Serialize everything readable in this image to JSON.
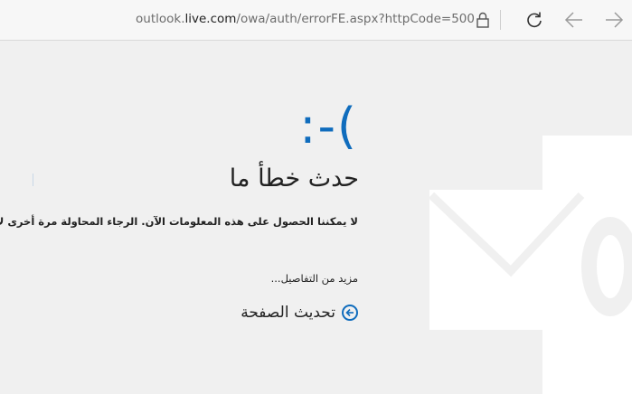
{
  "browser": {
    "url_prefix": "outlook.",
    "url_host": "live.com",
    "url_path": "/owa/auth/errorFE.aspx?httpCode=500",
    "url_full": "outlook.live.com/owa/auth/errorFE.aspx?httpCode=500"
  },
  "error": {
    "emoticon": ":-(",
    "heading": "حدث خطأ ما",
    "message": "لا يمكننا الحصول على هذه المعلومات الآن. الرجاء المحاولة مرة أخرى لاحقًا.",
    "more_details": "مزيد من التفاصيل...",
    "refresh_label": "تحديث الصفحة"
  },
  "colors": {
    "accent": "#0f6cbd",
    "background": "#f0f0f0",
    "logo": "#ffffff"
  },
  "icons": [
    "back-arrow-icon",
    "forward-arrow-icon",
    "refresh-icon",
    "lock-icon",
    "outlook-logo-icon",
    "arrow-left-circle-icon"
  ]
}
